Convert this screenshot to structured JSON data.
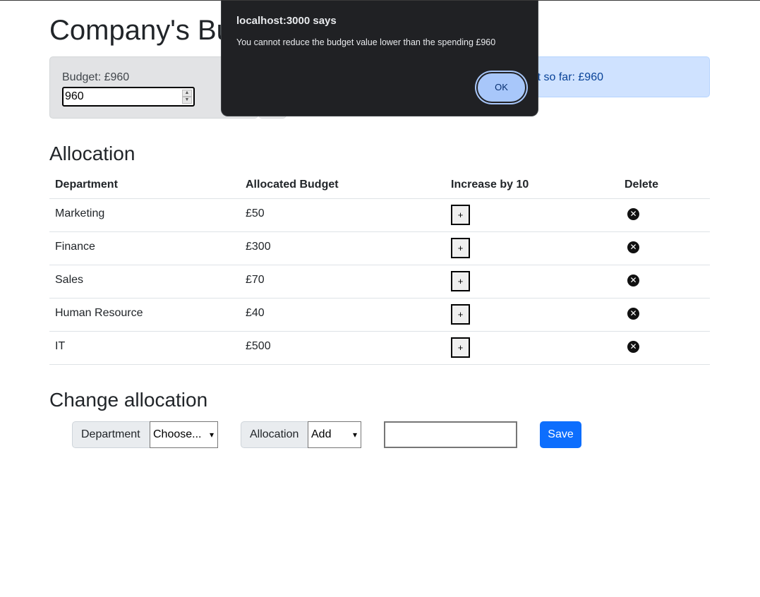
{
  "page": {
    "title": "Company's Bu",
    "budget_label": "Budget: £960",
    "budget_value": "960",
    "spent_label": "t so far: £960"
  },
  "allocation": {
    "heading": "Allocation",
    "columns": [
      "Department",
      "Allocated Budget",
      "Increase by 10",
      "Delete"
    ],
    "rows": [
      {
        "department": "Marketing",
        "budget": "£50"
      },
      {
        "department": "Finance",
        "budget": "£300"
      },
      {
        "department": "Sales",
        "budget": "£70"
      },
      {
        "department": "Human Resource",
        "budget": "£40"
      },
      {
        "department": "IT",
        "budget": "£500"
      }
    ],
    "increase_label": "+",
    "delete_icon": "close-circle-icon"
  },
  "change": {
    "heading": "Change allocation",
    "department_label": "Department",
    "department_selected": "Choose...",
    "allocation_label": "Allocation",
    "allocation_selected": "Add",
    "cost_value": "",
    "save_label": "Save"
  },
  "dialog": {
    "title": "localhost:3000 says",
    "message": "You cannot reduce the budget value lower than the spending £960",
    "ok_label": "OK"
  },
  "colors": {
    "primary": "#0d6efd",
    "secondary_bg": "#e2e3e5",
    "info_bg": "#cfe2ff",
    "dialog_bg": "#202124",
    "ok_bg": "#a8c7fa"
  }
}
